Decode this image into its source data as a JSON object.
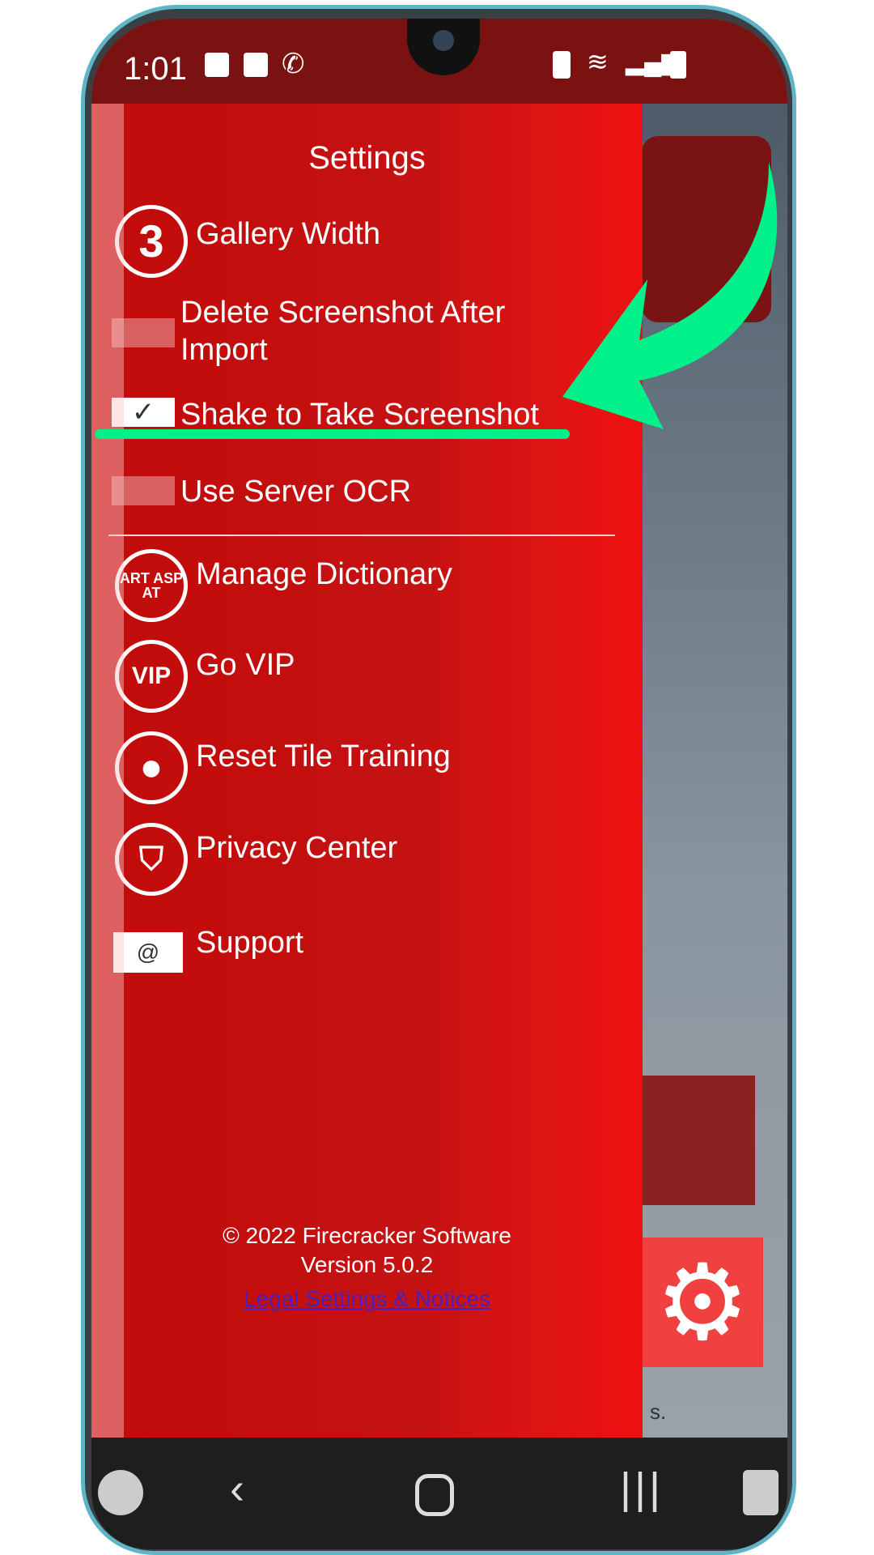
{
  "status_bar": {
    "time": "1:01",
    "left_icons": [
      "image-icon",
      "clock-icon",
      "viber-icon"
    ],
    "right_icons": [
      "battery-saver-icon",
      "wifi-icon",
      "signal-icon",
      "battery-icon"
    ]
  },
  "drawer": {
    "title": "Settings",
    "items": [
      {
        "label": "Gallery Width",
        "icon": "number-3-icon",
        "value": "3"
      },
      {
        "label": "Delete Screenshot After Import",
        "icon": "toggle-off-icon",
        "checked": false
      },
      {
        "label": "Shake to Take Screenshot",
        "icon": "checkbox-checked-icon",
        "checked": true
      },
      {
        "label": "Use Server OCR",
        "icon": "toggle-off-icon",
        "checked": false
      },
      {
        "label": "Manage Dictionary",
        "icon": "dictionary-icon",
        "icon_text": "ART ASP AT"
      },
      {
        "label": "Go VIP",
        "icon": "vip-icon",
        "icon_text": "VIP"
      },
      {
        "label": "Reset Tile Training",
        "icon": "bomb-icon"
      },
      {
        "label": "Privacy Center",
        "icon": "shield-person-icon"
      },
      {
        "label": "Support",
        "icon": "envelope-icon",
        "icon_text": "@"
      }
    ],
    "footer": {
      "copyright": "© 2022 Firecracker Software",
      "version": "Version 5.0.2",
      "legal_link": "Legal Settings & Notices"
    }
  },
  "background_fragment": "s.",
  "annotation": {
    "color": "#00f08a"
  },
  "colors": {
    "drawer": "#c51212",
    "status_bar": "#7a1212",
    "nav_bar": "#1e1e1e",
    "link": "#4a1fbf"
  }
}
